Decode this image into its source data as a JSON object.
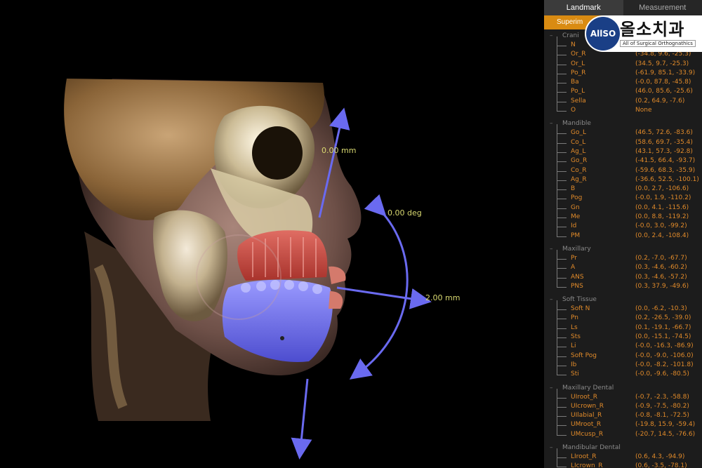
{
  "viewport": {
    "label_top": "0.00 mm",
    "label_rotation": "0.00 deg",
    "label_horizontal": "2.00 mm"
  },
  "tabs": {
    "landmark": "Landmark",
    "measurement": "Measurement"
  },
  "subbar": "Superim",
  "logo": {
    "circle_text": "AllSO",
    "korean": "올소치과",
    "subtitle": "All of Surgical Orthognathics"
  },
  "groups": [
    {
      "title": "Crani",
      "items": [
        {
          "name": "N",
          "value": ""
        },
        {
          "name": "Or_R",
          "value": "(-34.8, 9.6, -25.3)"
        },
        {
          "name": "Or_L",
          "value": "(34.5, 9.7, -25.3)"
        },
        {
          "name": "Po_R",
          "value": "(-61.9, 85.1, -33.9)"
        },
        {
          "name": "Ba",
          "value": "(-0.0, 87.8, -45.8)"
        },
        {
          "name": "Po_L",
          "value": "(46.0, 85.6, -25.6)"
        },
        {
          "name": "Sella",
          "value": "(0.2, 64.9, -7.6)"
        },
        {
          "name": "O",
          "value": "None"
        }
      ]
    },
    {
      "title": "Mandible",
      "items": [
        {
          "name": "Go_L",
          "value": "(46.5, 72.6, -83.6)"
        },
        {
          "name": "Co_L",
          "value": "(58.6, 69.7, -35.4)"
        },
        {
          "name": "Ag_L",
          "value": "(43.1, 57.3, -92.8)"
        },
        {
          "name": "Go_R",
          "value": "(-41.5, 66.4, -93.7)"
        },
        {
          "name": "Co_R",
          "value": "(-59.6, 68.3, -35.9)"
        },
        {
          "name": "Ag_R",
          "value": "(-36.6, 52.5, -100.1)"
        },
        {
          "name": "B",
          "value": "(0.0, 2.7, -106.6)"
        },
        {
          "name": "Pog",
          "value": "(-0.0, 1.9, -110.2)"
        },
        {
          "name": "Gn",
          "value": "(0.0, 4.1, -115.6)"
        },
        {
          "name": "Me",
          "value": "(0.0, 8.8, -119.2)"
        },
        {
          "name": "Id",
          "value": "(-0.0, 3.0, -99.2)"
        },
        {
          "name": "PM",
          "value": "(0.0, 2.4, -108.4)"
        }
      ]
    },
    {
      "title": "Maxillary",
      "items": [
        {
          "name": "Pr",
          "value": "(0.2, -7.0, -67.7)"
        },
        {
          "name": "A",
          "value": "(0.3, -4.6, -60.2)"
        },
        {
          "name": "ANS",
          "value": "(0.3, -4.6, -57.2)"
        },
        {
          "name": "PNS",
          "value": "(0.3, 37.9, -49.6)"
        }
      ]
    },
    {
      "title": "Soft Tissue",
      "items": [
        {
          "name": "Soft N",
          "value": "(0.0, -6.2, -10.3)"
        },
        {
          "name": "Pn",
          "value": "(0.2, -26.5, -39.0)"
        },
        {
          "name": "Ls",
          "value": "(0.1, -19.1, -66.7)"
        },
        {
          "name": "Sts",
          "value": "(0.0, -15.1, -74.5)"
        },
        {
          "name": "Li",
          "value": "(-0.0, -16.3, -86.9)"
        },
        {
          "name": "Soft Pog",
          "value": "(-0.0, -9.0, -106.0)"
        },
        {
          "name": "Ib",
          "value": "(-0.0, -8.2, -101.8)"
        },
        {
          "name": "Sti",
          "value": "(-0.0, -9.6, -80.5)"
        }
      ]
    },
    {
      "title": "Maxillary Dental",
      "items": [
        {
          "name": "UIroot_R",
          "value": "(-0.7, -2.3, -58.8)"
        },
        {
          "name": "UIcrown_R",
          "value": "(-0.9, -7.5, -80.2)"
        },
        {
          "name": "UIlabial_R",
          "value": "(-0.8, -8.1, -72.5)"
        },
        {
          "name": "UMroot_R",
          "value": "(-19.8, 15.9, -59.4)"
        },
        {
          "name": "UMcusp_R",
          "value": "(-20.7, 14.5, -76.6)"
        }
      ]
    },
    {
      "title": "Mandibular Dental",
      "items": [
        {
          "name": "LIroot_R",
          "value": "(0.6, 4.3, -94.9)"
        },
        {
          "name": "LIcrown_R",
          "value": "(0.6, -3.5, -78.1)"
        }
      ]
    }
  ]
}
